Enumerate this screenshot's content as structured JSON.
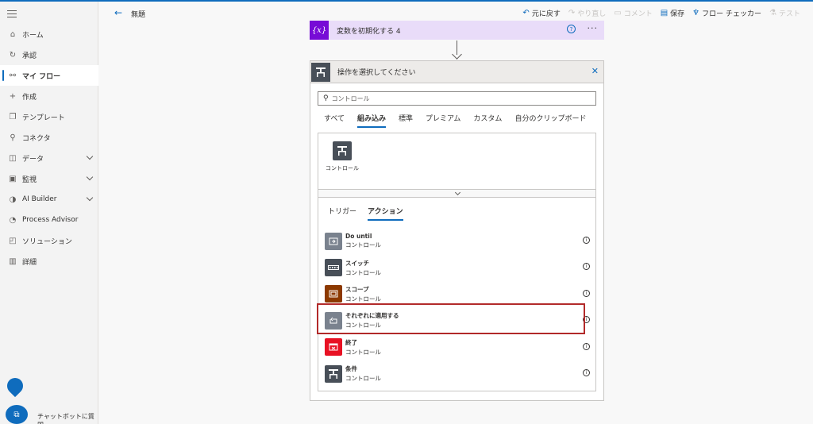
{
  "sidebar": {
    "items": [
      {
        "label": "ホーム",
        "icon": "home-icon",
        "active": false,
        "expandable": false
      },
      {
        "label": "承認",
        "icon": "approvals-icon",
        "active": false,
        "expandable": false
      },
      {
        "label": "マイ フロー",
        "icon": "flows-icon",
        "active": true,
        "expandable": false
      },
      {
        "label": "作成",
        "icon": "plus-icon",
        "active": false,
        "expandable": false
      },
      {
        "label": "テンプレート",
        "icon": "templates-icon",
        "active": false,
        "expandable": false
      },
      {
        "label": "コネクタ",
        "icon": "connectors-icon",
        "active": false,
        "expandable": false
      },
      {
        "label": "データ",
        "icon": "database-icon",
        "active": false,
        "expandable": true
      },
      {
        "label": "監視",
        "icon": "monitor-icon",
        "active": false,
        "expandable": true
      },
      {
        "label": "AI Builder",
        "icon": "ai-builder-icon",
        "active": false,
        "expandable": true
      },
      {
        "label": "Process Advisor",
        "icon": "process-advisor-icon",
        "active": false,
        "expandable": false
      },
      {
        "label": "ソリューション",
        "icon": "solutions-icon",
        "active": false,
        "expandable": false
      },
      {
        "label": "詳細",
        "icon": "book-icon",
        "active": false,
        "expandable": false
      }
    ],
    "chatbot_label": "チャットボットに質問"
  },
  "header": {
    "title": "無題",
    "toolbar": {
      "undo": "元に戻す",
      "redo": "やり直し",
      "comment": "コメント",
      "save": "保存",
      "flow_checker": "フロー チェッカー",
      "test": "テスト"
    }
  },
  "var_card": {
    "title": "変数を初期化する 4",
    "icon_text": "{x}",
    "help": "?",
    "more": "···"
  },
  "panel": {
    "title": "操作を選択してください",
    "search_placeholder": "コントロール",
    "tabs": [
      "すべて",
      "組み込み",
      "標準",
      "プレミアム",
      "カスタム",
      "自分のクリップボード"
    ],
    "active_tab": 1,
    "connector_label": "コントロール",
    "subtabs": [
      "トリガー",
      "アクション"
    ],
    "active_subtab": 1,
    "actions": [
      {
        "name": "Do until",
        "sub": "コントロール",
        "color": "#7a828e",
        "icon": "loop-icon"
      },
      {
        "name": "スイッチ",
        "sub": "コントロール",
        "color": "#484f58",
        "icon": "switch-icon"
      },
      {
        "name": "スコープ",
        "sub": "コントロール",
        "color": "#8c3900",
        "icon": "scope-icon"
      },
      {
        "name": "それぞれに適用する",
        "sub": "コントロール",
        "color": "#7a828e",
        "icon": "apply-to-each-icon"
      },
      {
        "name": "終了",
        "sub": "コントロール",
        "color": "#e81123",
        "icon": "terminate-icon"
      },
      {
        "name": "条件",
        "sub": "コントロール",
        "color": "#484f58",
        "icon": "condition-icon"
      }
    ]
  },
  "colors": {
    "accent": "#0f6cbd",
    "variable": "#770bd6",
    "highlight": "#b22a2a"
  }
}
